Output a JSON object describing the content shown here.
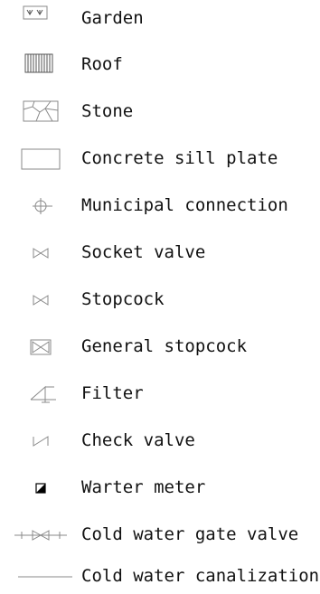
{
  "legend": {
    "items": [
      {
        "symbol": "garden-symbol",
        "label": "Garden"
      },
      {
        "symbol": "roof-symbol",
        "label": "Roof"
      },
      {
        "symbol": "stone-symbol",
        "label": "Stone"
      },
      {
        "symbol": "concrete-sill-plate-symbol",
        "label": "Concrete sill plate"
      },
      {
        "symbol": "municipal-connection-symbol",
        "label": "Municipal connection"
      },
      {
        "symbol": "socket-valve-symbol",
        "label": "Socket valve"
      },
      {
        "symbol": "stopcock-symbol",
        "label": "Stopcock"
      },
      {
        "symbol": "general-stopcock-symbol",
        "label": "General stopcock"
      },
      {
        "symbol": "filter-symbol",
        "label": "Filter"
      },
      {
        "symbol": "check-valve-symbol",
        "label": "Check valve"
      },
      {
        "symbol": "water-meter-symbol",
        "label": "Warter meter"
      },
      {
        "symbol": "cold-water-gate-valve-symbol",
        "label": "Cold water gate valve"
      },
      {
        "symbol": "cold-water-canalization-symbol",
        "label": "Cold water canalization"
      }
    ]
  }
}
